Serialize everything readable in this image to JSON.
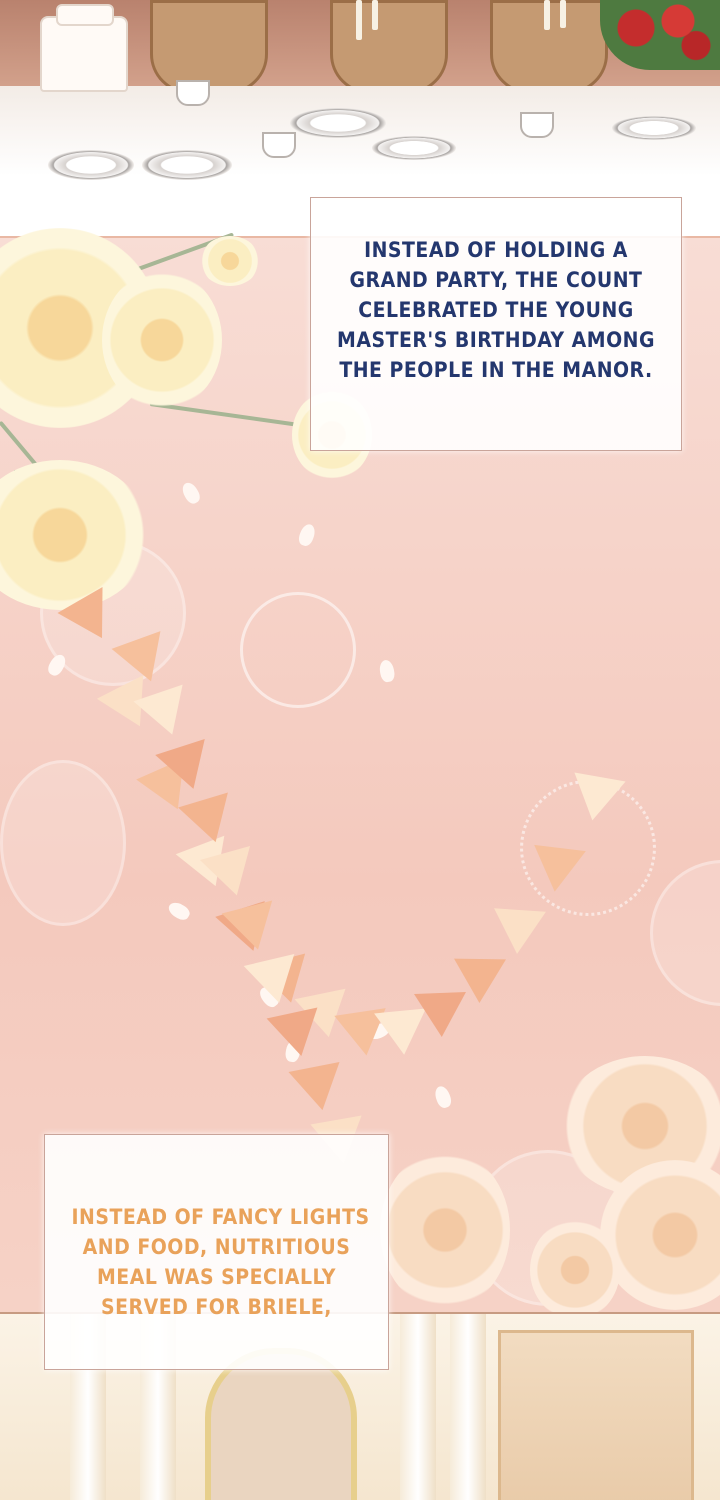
{
  "captions": {
    "top": {
      "lines": [
        "INSTEAD OF HOLDING A",
        "GRAND PARTY, THE COUNT",
        "CELEBRATED THE YOUNG",
        "MASTER'S BIRTHDAY AMONG",
        "THE PEOPLE IN THE MANOR."
      ]
    },
    "bottom": {
      "lines": [
        "INSTEAD OF FANCY LIGHTS",
        "AND FOOD, NUTRITIOUS",
        "MEAL WAS SPECIALLY",
        "SERVED FOR BRIELE,"
      ]
    }
  },
  "colors": {
    "top_caption_text": "#24376e",
    "bottom_caption_text": "#e9a25a",
    "background_pink": "#f6d2c6"
  }
}
